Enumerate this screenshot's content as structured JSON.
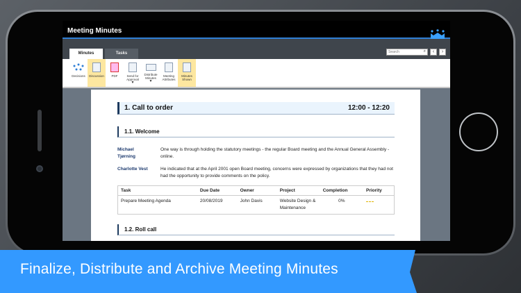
{
  "app": {
    "title": "Meeting Minutes"
  },
  "tabs": [
    {
      "label": "Minutes"
    },
    {
      "label": "Tasks"
    }
  ],
  "search": {
    "placeholder": "Search"
  },
  "toolbar": [
    {
      "label": "Decisions",
      "icon": "decisions-icon"
    },
    {
      "label": "Discussion",
      "icon": "discussion-icon",
      "highlighted": true
    },
    {
      "label": "PDF",
      "icon": "pdf-icon"
    },
    {
      "label": "Send for Approval",
      "icon": "send-approval-icon",
      "dropdown": true
    },
    {
      "label": "Distribute Minutes",
      "icon": "distribute-icon",
      "dropdown": true
    },
    {
      "label": "Meeting Attributes",
      "icon": "attributes-icon"
    },
    {
      "label": "Minutes Shown",
      "icon": "minutes-shown-icon",
      "highlighted": true
    }
  ],
  "document": {
    "section": {
      "title": "1. Call to order",
      "time": "12:00 - 12:20"
    },
    "sub1": "1.1. Welcome",
    "entries": [
      {
        "who": "Michael Tjørning",
        "text": "One way is through holding the statutory meetings - the regular Board meeting and the Annual General Assembly - online."
      },
      {
        "who": "Charlotte Vest",
        "text": "He indicated that at the April 2001 open Board meeting, concerns were expressed by organizations that they had not had the opportunity to provide comments on the policy."
      }
    ],
    "table": {
      "headers": [
        "Task",
        "Due Date",
        "Owner",
        "Project",
        "Completion",
        "Priority"
      ],
      "rows": [
        [
          "Prepare Meeting Agenda",
          "20/08/2019",
          "John Davis",
          "Website Design & Maintenance",
          "0%",
          ""
        ]
      ]
    },
    "sub2": "1.2. Roll call"
  },
  "banner": {
    "text": "Finalize, Distribute and Archive Meeting Minutes"
  },
  "colors": {
    "accent": "#3399ff",
    "highlight": "#fde7a0"
  }
}
